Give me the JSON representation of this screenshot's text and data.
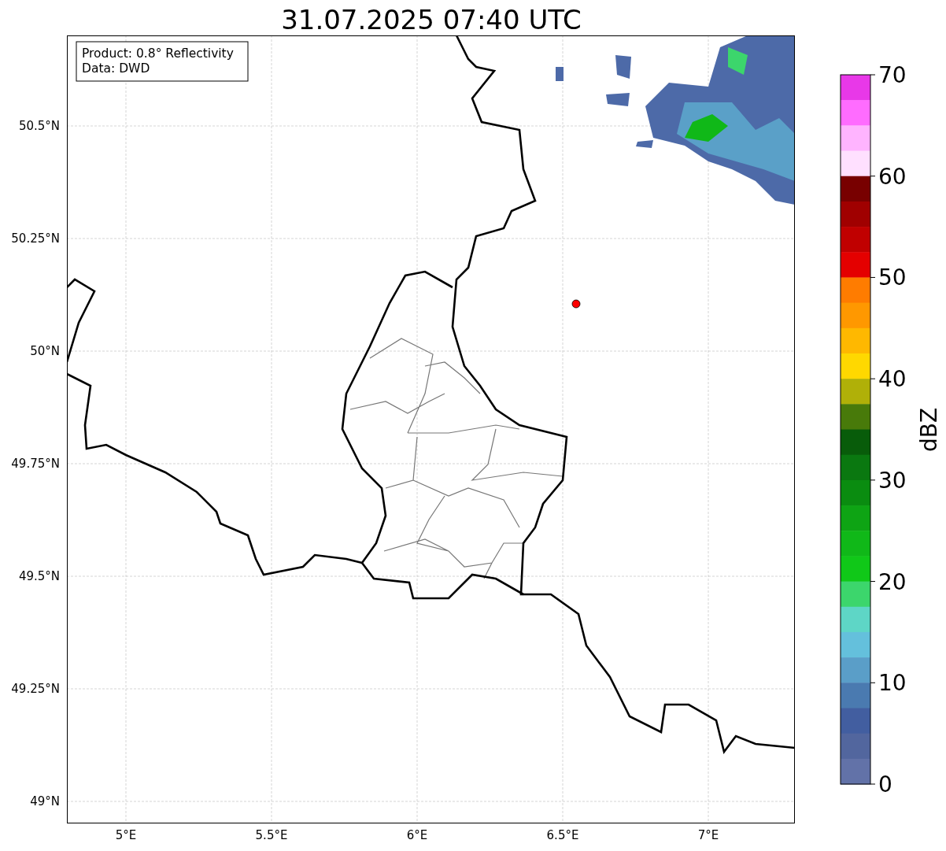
{
  "title": "31.07.2025 07:40 UTC",
  "info_box": {
    "lines": [
      "Product: 0.8° Reflectivity",
      "Data: DWD"
    ]
  },
  "y_ticks": [
    "50.5°N",
    "50.25°N",
    "50°N",
    "49.75°N",
    "49.5°N",
    "49.25°N",
    "49°N"
  ],
  "x_ticks": [
    "5°E",
    "5.5°E",
    "6°E",
    "6.5°E",
    "7°E"
  ],
  "colorbar": {
    "label": "dBZ",
    "ticks": [
      "70",
      "60",
      "50",
      "40",
      "30",
      "20",
      "10",
      "0"
    ],
    "bins": [
      {
        "color": "#e838e8"
      },
      {
        "color": "#ff6cff"
      },
      {
        "color": "#ffb4ff"
      },
      {
        "color": "#ffe0ff"
      },
      {
        "color": "#780000"
      },
      {
        "color": "#a00000"
      },
      {
        "color": "#c00000"
      },
      {
        "color": "#e40000"
      },
      {
        "color": "#ff7c00"
      },
      {
        "color": "#ff9800"
      },
      {
        "color": "#ffb800"
      },
      {
        "color": "#ffd800"
      },
      {
        "color": "#b0b008"
      },
      {
        "color": "#487a0a"
      },
      {
        "color": "#085c0a"
      },
      {
        "color": "#0a7810"
      },
      {
        "color": "#0a8c10"
      },
      {
        "color": "#0ea414"
      },
      {
        "color": "#10b818"
      },
      {
        "color": "#10c818"
      },
      {
        "color": "#3cd66c"
      },
      {
        "color": "#5ed6c6"
      },
      {
        "color": "#64c0dc"
      },
      {
        "color": "#5a9ec8"
      },
      {
        "color": "#4a7ab0"
      },
      {
        "color": "#425ea0"
      },
      {
        "color": "#52669e"
      },
      {
        "color": "#6272a8"
      }
    ]
  }
}
